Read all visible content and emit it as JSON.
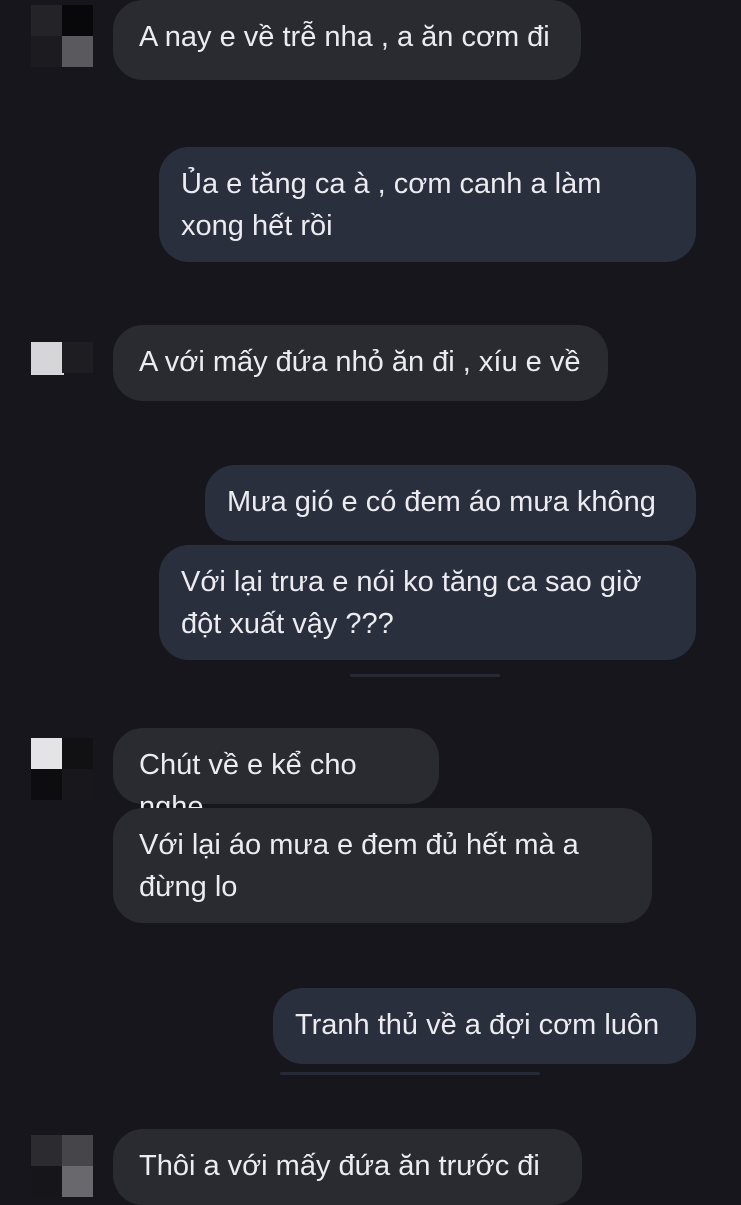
{
  "conversation": {
    "messages": [
      {
        "from": "contact",
        "text": "A nay e về trễ nha , a ăn cơm đi"
      },
      {
        "from": "me",
        "text": "Ủa e tăng ca à , cơm canh a làm\nxong hết rồi"
      },
      {
        "from": "contact",
        "text": "A với mấy đứa nhỏ ăn đi , xíu e về"
      },
      {
        "from": "me",
        "text": "Mưa gió e có đem áo mưa không"
      },
      {
        "from": "me",
        "text": "Với lại trưa e nói ko tăng ca sao giờ\nđột xuất vậy ???"
      },
      {
        "from": "contact",
        "text": "Chút về e kể cho nghe"
      },
      {
        "from": "contact",
        "text": "Với lại áo mưa e đem đủ hết mà a\nđừng lo"
      },
      {
        "from": "me",
        "text": "Tranh thủ về a đợi cơm luôn"
      },
      {
        "from": "contact",
        "text": "Thôi a với mấy đứa ăn trước đi"
      }
    ]
  },
  "colors": {
    "background": "#16161c",
    "incoming_bubble": "#2a2b30",
    "outgoing_bubble": "#2a2f3e",
    "text": "#ececf0"
  },
  "avatar": {
    "icon": "pixelated-avatar-icon",
    "note": ""
  }
}
